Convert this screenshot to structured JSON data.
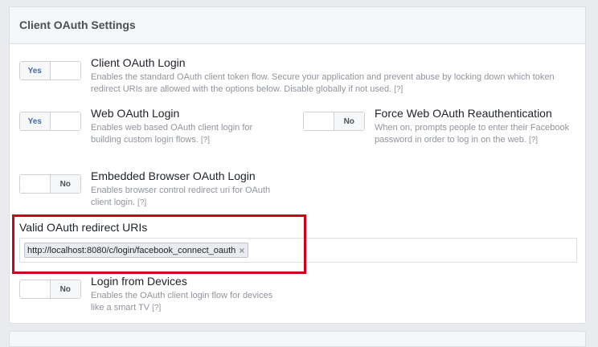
{
  "panel": {
    "title": "Client OAuth Settings"
  },
  "settings": {
    "client_oauth_login": {
      "title": "Client OAuth Login",
      "desc": "Enables the standard OAuth client token flow. Secure your application and prevent abuse by locking down which token redirect URIs are allowed with the options below. Disable globally if not used.",
      "help": "[?]",
      "toggle_label": "Yes",
      "state": "on"
    },
    "web_oauth_login": {
      "title": "Web OAuth Login",
      "desc": "Enables web based OAuth client login for building custom login flows.",
      "help": "[?]",
      "toggle_label": "Yes",
      "state": "on"
    },
    "force_web_oauth_reauth": {
      "title": "Force Web OAuth Reauthentication",
      "desc": "When on, prompts people to enter their Facebook password in order to log in on the web.",
      "help": "[?]",
      "toggle_label": "No",
      "state": "off"
    },
    "embedded_browser_oauth_login": {
      "title": "Embedded Browser OAuth Login",
      "desc": "Enables browser control redirect uri for OAuth client login.",
      "help": "[?]",
      "toggle_label": "No",
      "state": "off"
    },
    "login_from_devices": {
      "title": "Login from Devices",
      "desc": "Enables the OAuth client login flow for devices like a smart TV",
      "help": "[?]",
      "toggle_label": "No",
      "state": "off"
    }
  },
  "redirect_uris": {
    "label": "Valid OAuth redirect URIs",
    "tokens": [
      "http://localhost:8080/c/login/facebook_connect_oauth"
    ],
    "remove_glyph": "×"
  },
  "colors": {
    "accent": "#4267b2",
    "highlight_border": "#d0021b",
    "muted_text": "#90949c"
  }
}
